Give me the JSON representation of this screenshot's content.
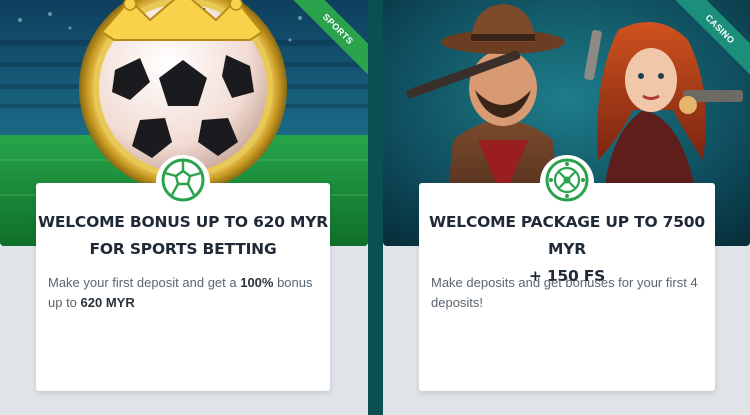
{
  "sports": {
    "ribbon": "SPORTS",
    "title_line1": "WELCOME BONUS UP TO 620 MYR",
    "title_line2": "FOR SPORTS BETTING",
    "desc_part1": "Make your first deposit and get a ",
    "desc_bold1": "100%",
    "desc_part2": " bonus up to ",
    "desc_bold2": "620 MYR",
    "icon": "soccer-ball-icon"
  },
  "casino": {
    "ribbon": "CASINO",
    "title_line1": "WELCOME PACKAGE UP TO 7500 MYR",
    "title_line2": "+ 150 FS",
    "desc": "Make deposits and get bonuses for your first 4 deposits!",
    "icon": "roulette-icon"
  },
  "colors": {
    "accent_green": "#2ba24c",
    "divider": "#0c4f53",
    "title_text": "#1f2a36",
    "body_text": "#5b6670"
  }
}
